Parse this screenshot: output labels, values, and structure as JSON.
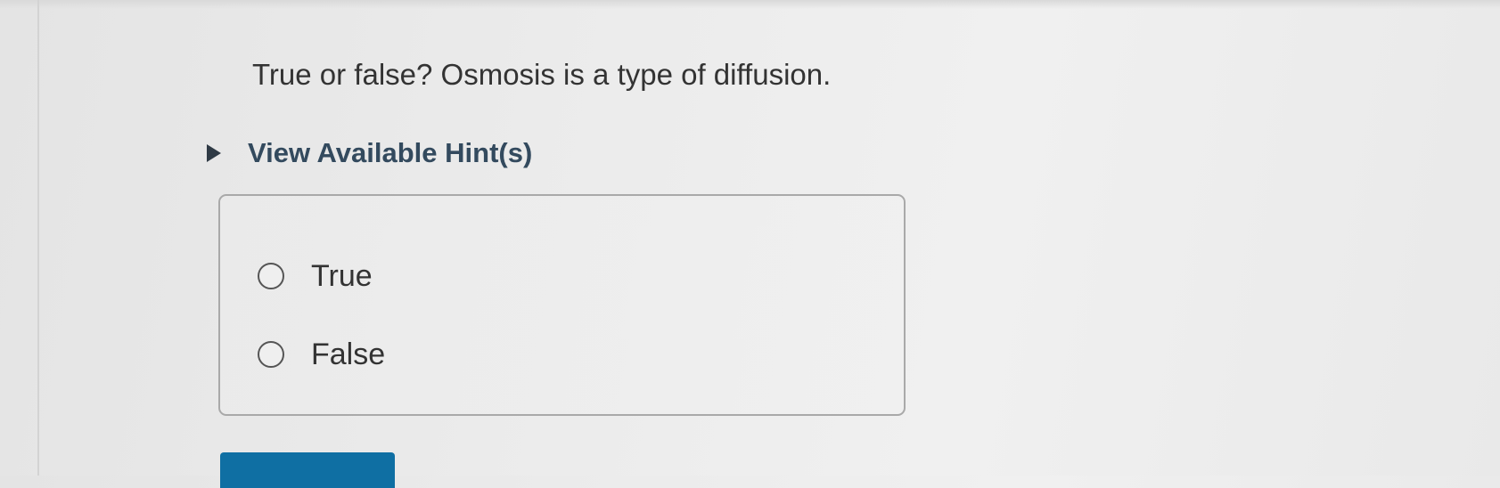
{
  "question": {
    "text": "True or false? Osmosis is a type of diffusion."
  },
  "hint": {
    "label": "View Available Hint(s)",
    "icon": "caret-right-icon"
  },
  "options": [
    {
      "label": "True",
      "selected": false
    },
    {
      "label": "False",
      "selected": false
    }
  ],
  "colors": {
    "hint_text": "#334a5e",
    "submit_button": "#0f6fa3",
    "box_border": "#a9a9a9"
  }
}
